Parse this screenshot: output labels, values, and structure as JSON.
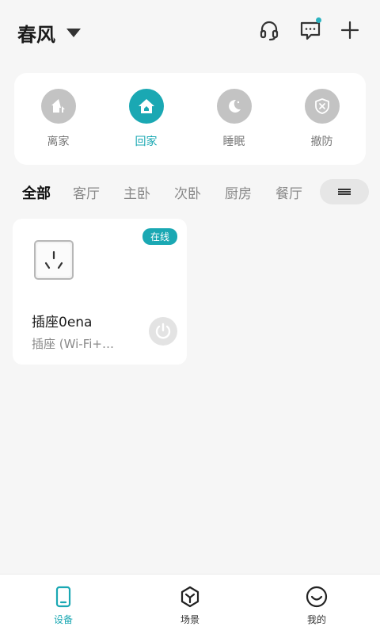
{
  "header": {
    "home_name": "春风",
    "icons": [
      "headset-icon",
      "message-icon",
      "add-icon"
    ]
  },
  "modes": [
    {
      "label": "离家",
      "icon": "leave-home-icon",
      "active": false
    },
    {
      "label": "回家",
      "icon": "home-icon",
      "active": true
    },
    {
      "label": "睡眠",
      "icon": "sleep-moon-icon",
      "active": false
    },
    {
      "label": "撤防",
      "icon": "disarm-shield-icon",
      "active": false
    }
  ],
  "rooms": {
    "tabs": [
      "全部",
      "客厅",
      "主卧",
      "次卧",
      "厨房",
      "餐厅"
    ],
    "active_index": 0
  },
  "device": {
    "status": "在线",
    "name": "插座0ena",
    "type": "插座 (Wi-Fi+…"
  },
  "bottom_nav": [
    {
      "label": "设备",
      "icon": "device-icon",
      "active": true
    },
    {
      "label": "场景",
      "icon": "scene-cube-icon",
      "active": false
    },
    {
      "label": "我的",
      "icon": "profile-smile-icon",
      "active": false
    }
  ],
  "colors": {
    "accent": "#1aa8b3",
    "inactive_circle": "#c3c3c3",
    "background": "#f6f6f6"
  }
}
